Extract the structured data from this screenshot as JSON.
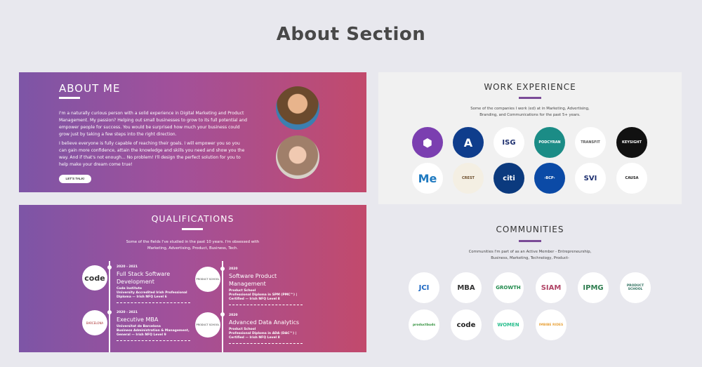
{
  "page_title": "About Section",
  "about": {
    "heading": "ABOUT ME",
    "paragraph1": "I'm a naturally curious person with a solid experience in Digital Marketing and Product Management. My passion? Helping out small businesses to grow to its full potential and empower people for success. You would be surprised how much your business could grow just by taking a few steps into the right direction.",
    "paragraph2": "I believe everyone is fully capable of reaching their goals. I will empower you so you can gain more confidence, attain the knowledge and skills you need and show you the way. And if that's not enough... No problem! I'll design the perfect solution for you to help make your dream come true!",
    "cta": "LET'S TALK!"
  },
  "work": {
    "heading": "WORK EXPERIENCE",
    "desc1": "Some of the companies I work (ed) at in Marketing, Advertising,",
    "desc2": "Branding, and Communications for the past 5+ years.",
    "logos": [
      {
        "name": "hex-logo",
        "text": "⬢",
        "bg": "#7b3fb0",
        "fg": "#ffffff"
      },
      {
        "name": "a-logo",
        "text": "A",
        "bg": "#0f3d8c",
        "fg": "#ffffff"
      },
      {
        "name": "isg-logo",
        "text": "ISG",
        "bg": "#ffffff",
        "fg": "#1d2f6f"
      },
      {
        "name": "podcasts-logo",
        "text": "PODCYRAN",
        "bg": "#1b8c86",
        "fg": "#ffffff"
      },
      {
        "name": "transfit-logo",
        "text": "TRANSFIT",
        "bg": "#ffffff",
        "fg": "#555555"
      },
      {
        "name": "keysight-logo",
        "text": "KEYSIGHT",
        "bg": "#111111",
        "fg": "#ffffff"
      },
      {
        "name": "me-logo",
        "text": "Me",
        "bg": "#ffffff",
        "fg": "#1f7ac0"
      },
      {
        "name": "crest-logo",
        "text": "CREST",
        "bg": "#f4efe3",
        "fg": "#6b4c2a"
      },
      {
        "name": "citi-logo",
        "text": "citi",
        "bg": "#0b3a7e",
        "fg": "#ffffff"
      },
      {
        "name": "bcp-logo",
        "text": "›BCP›",
        "bg": "#0b4aa6",
        "fg": "#ffffff"
      },
      {
        "name": "svi-logo",
        "text": "SVI",
        "bg": "#ffffff",
        "fg": "#1d2f6f"
      },
      {
        "name": "causa-logo",
        "text": "CAUSA",
        "bg": "#ffffff",
        "fg": "#222222"
      }
    ]
  },
  "qualifications": {
    "heading": "QUALIFICATIONS",
    "desc1": "Some of the fields I've studied in the past 10 years. I'm obsessed with",
    "desc2": "Marketing, Advertising, Product, Business, Tech.",
    "items": [
      {
        "years": "2020 - 2021",
        "title": "Full Stack Software Development",
        "institution": "Code Institute",
        "detail1": "University Accredited Irish Professional",
        "detail2": "Diploma — Irish NFQ Level 6",
        "logo": "code"
      },
      {
        "years": "2020",
        "title": "Software Product Management",
        "institution": "Product School",
        "detail1": "Professional Diploma in SPM (PMC™) |",
        "detail2": "Certified — Irish NFQ Level 8",
        "logo": "PRODUCT SCHOOL"
      },
      {
        "years": "2020 - 2021",
        "title": "Executive MBA",
        "institution": "Universitat de Barcelona",
        "detail1": "Business Administration & Management,",
        "detail2": "General — Irish NFQ Level 9",
        "logo": "BARCELONA"
      },
      {
        "years": "2020",
        "title": "Advanced Data Analytics",
        "institution": "Product School",
        "detail1": "Professional Diploma in ADA (DAC™) |",
        "detail2": "Certified — Irish NFQ Level 8",
        "logo": "PRODUCT SCHOOL"
      }
    ]
  },
  "communities": {
    "heading": "COMMUNITIES",
    "desc1": "Communities I'm part of as an Active Member - Entrepreneurship,",
    "desc2": "Business, Marketing, Technology, Product-",
    "logos": [
      {
        "name": "jci-logo",
        "text": "JCI",
        "fg": "#1a66c2"
      },
      {
        "name": "mba-logo",
        "text": "MBA",
        "fg": "#333333"
      },
      {
        "name": "growth-logo",
        "text": "GROWTH",
        "fg": "#1f8a4c"
      },
      {
        "name": "siam-logo",
        "text": "SIAM",
        "fg": "#b04466"
      },
      {
        "name": "ipmg-logo",
        "text": "IPMG",
        "fg": "#2e7d4f"
      },
      {
        "name": "product-school-logo",
        "text": "PRODUCT SCHOOL",
        "fg": "#2b6e5c"
      },
      {
        "name": "productbuds-logo",
        "text": "productbuds",
        "fg": "#2f8f3a"
      },
      {
        "name": "code-logo",
        "text": "code",
        "fg": "#222222"
      },
      {
        "name": "women-logo",
        "text": "WOMEN",
        "fg": "#2bbf8f"
      },
      {
        "name": "ibusiness-logo",
        "text": "IMBIBE RIDES",
        "fg": "#e8a23a"
      }
    ]
  }
}
